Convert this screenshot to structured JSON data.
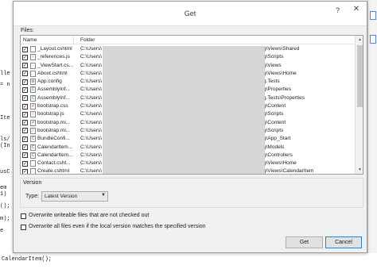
{
  "background_code": {
    "left_lines": [
      "lle",
      "= n",
      "Ite",
      "ls/",
      "(In",
      "usC",
      "em",
      "1)",
      "();",
      "m);",
      "e"
    ],
    "bottom_line": "CalendarItem();"
  },
  "dialog": {
    "title": "Get",
    "help_glyph": "?",
    "close_glyph": "✕",
    "files_label": "Files:",
    "columns": {
      "name": "Name",
      "folder": "Folder"
    },
    "files": [
      {
        "name": "_Layout.cshtml",
        "folder": "C:\\Users\\",
        "tail": "g\\Views\\Shared",
        "icon": "page-icon"
      },
      {
        "name": "_references.js",
        "folder": "C:\\Users\\",
        "tail": "g\\Scripts",
        "icon": "js-file-icon"
      },
      {
        "name": "_ViewStart.cs...",
        "folder": "C:\\Users\\",
        "tail": "g\\Views",
        "icon": "page-icon"
      },
      {
        "name": "About.cshtml",
        "folder": "C:\\Users\\",
        "tail": "g\\Views\\Home",
        "icon": "page-icon"
      },
      {
        "name": "App.config",
        "folder": "C:\\Users\\",
        "tail": "g.Tests",
        "icon": "config-icon"
      },
      {
        "name": "AssemblyInf...",
        "folder": "C:\\Users\\",
        "tail": "g\\Properties",
        "icon": "csharp-file-icon"
      },
      {
        "name": "AssemblyInf...",
        "folder": "C:\\Users\\",
        "tail": "g.Tests\\Properties",
        "icon": "csharp-file-icon"
      },
      {
        "name": "bootstrap.css",
        "folder": "C:\\Users\\",
        "tail": "g\\Content",
        "icon": "css-file-icon"
      },
      {
        "name": "bootstrap.js",
        "folder": "C:\\Users\\",
        "tail": "g\\Scripts",
        "icon": "js-file-icon"
      },
      {
        "name": "bootstrap.mi...",
        "folder": "C:\\Users\\",
        "tail": "g\\Content",
        "icon": "css-file-icon"
      },
      {
        "name": "bootstrap.mi...",
        "folder": "C:\\Users\\",
        "tail": "g\\Scripts",
        "icon": "js-file-icon"
      },
      {
        "name": "BundleConfi...",
        "folder": "C:\\Users\\",
        "tail": "g\\App_Start",
        "icon": "csharp-file-icon"
      },
      {
        "name": "Calendarltem...",
        "folder": "C:\\Users\\",
        "tail": "g\\Models",
        "icon": "csharp-file-icon"
      },
      {
        "name": "CalendarItem...",
        "folder": "C:\\Users\\",
        "tail": "g\\Controllers",
        "icon": "csharp-file-icon"
      },
      {
        "name": "Contact.csht...",
        "folder": "C:\\Users\\",
        "tail": "g\\Views\\Home",
        "icon": "page-icon"
      },
      {
        "name": "Create.cshtml",
        "folder": "C:\\Users\\",
        "tail": "g\\Views\\CalendarItem",
        "icon": "page-icon"
      }
    ],
    "version": {
      "legend": "Version",
      "type_label": "Type:",
      "type_value": "Latest Version"
    },
    "options": {
      "overwrite_writeable": "Overwrite writeable files that are not checked out",
      "overwrite_all": "Overwrite all files even if the local version matches the specified version"
    },
    "buttons": {
      "get": "Get",
      "cancel": "Cancel"
    }
  }
}
